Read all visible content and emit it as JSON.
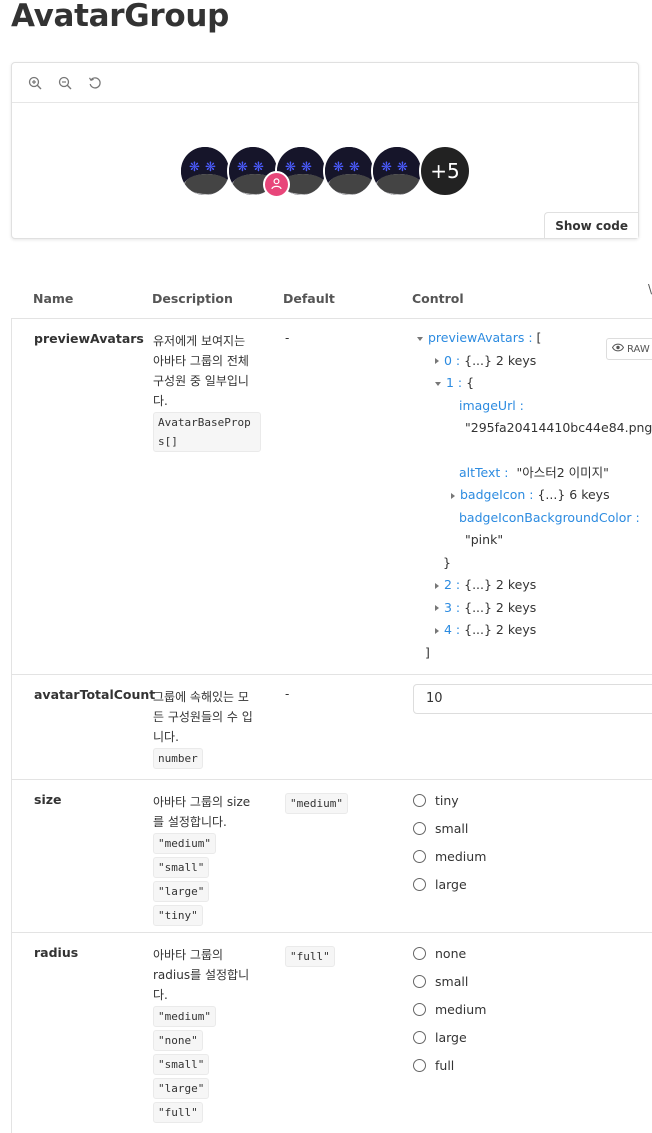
{
  "title": "AvatarGroup",
  "preview": {
    "show_code_label": "Show code",
    "more_count": "+5"
  },
  "table": {
    "headers": {
      "name": "Name",
      "description": "Description",
      "default": "Default",
      "control": "Control"
    },
    "rows": [
      {
        "name": "previewAvatars",
        "desc_lines": [
          "유저에게 보여지는",
          "아바타 그룹의 전체",
          "구성원 중 일부입니",
          "다."
        ],
        "type": "AvatarBaseProps[]",
        "default": "-",
        "json": {
          "root_key": "previewAvatars",
          "open": "[",
          "item0_key": "0",
          "item0_summary": "{...} 2 keys",
          "item1_key": "1",
          "item1_open": "{",
          "image_key": "imageUrl",
          "image_val": "\"295fa20414410bc44e84.png\"",
          "alt_key": "altText",
          "alt_val": "\"아스터2 이미지\"",
          "badge_key": "badgeIcon",
          "badge_summary": "{...} 6 keys",
          "bg_key": "badgeIconBackgroundColor",
          "bg_val": "\"pink\"",
          "item1_close": "}",
          "item2_key": "2",
          "item2_summary": "{...} 2 keys",
          "item3_key": "3",
          "item3_summary": "{...} 2 keys",
          "item4_key": "4",
          "item4_summary": "{...} 2 keys",
          "close": "]",
          "raw_label": "RAW"
        }
      },
      {
        "name": "avatarTotalCount",
        "desc_lines": [
          "그룹에 속해있는 모",
          "든 구성원들의 수 입",
          "니다."
        ],
        "type": "number",
        "default": "-",
        "value": "10"
      },
      {
        "name": "size",
        "desc_lines": [
          "아바타 그룹의 size",
          "를 설정합니다."
        ],
        "types": [
          "\"medium\"",
          "\"small\"",
          "\"large\"",
          "\"tiny\""
        ],
        "default": "\"medium\"",
        "options": [
          "tiny",
          "small",
          "medium",
          "large"
        ]
      },
      {
        "name": "radius",
        "desc_lines": [
          "아바타 그룹의",
          "radius를 설정합니",
          "다."
        ],
        "types": [
          "\"medium\"",
          "\"none\"",
          "\"small\"",
          "\"large\"",
          "\"full\""
        ],
        "default": "\"full\"",
        "options": [
          "none",
          "small",
          "medium",
          "large",
          "full"
        ]
      }
    ]
  },
  "colors": {
    "badge": "#e8467a",
    "json_key": "#2c8be0"
  },
  "icons": [
    "zoom-in-icon",
    "zoom-out-icon",
    "reset-zoom-icon",
    "user-icon",
    "eye-icon"
  ]
}
